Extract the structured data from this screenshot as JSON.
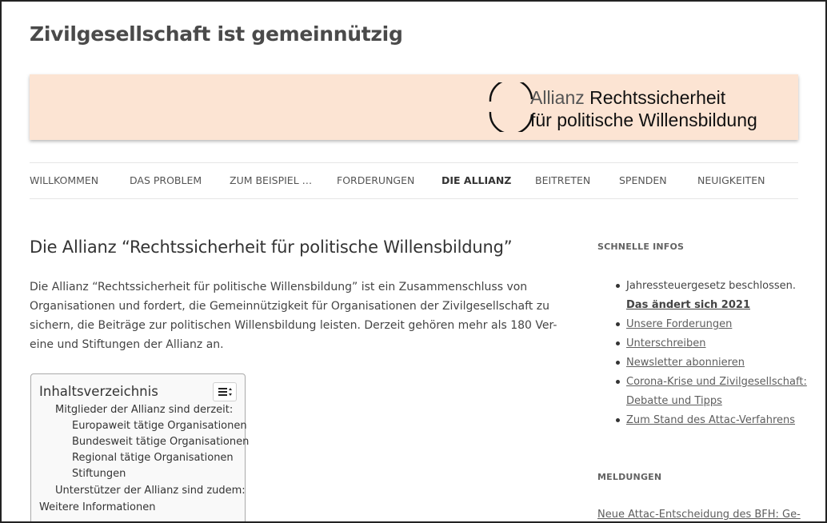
{
  "site": {
    "title": "Zivilgesellschaft ist gemeinnützig"
  },
  "banner": {
    "line1_light": "Allianz",
    "line1_bold": "Rechtssicherheit",
    "line2": "für politische Willensbildung"
  },
  "nav": {
    "items": [
      {
        "label": "Willkommen",
        "active": false
      },
      {
        "label": "Das Problem",
        "active": false
      },
      {
        "label": "Zum Beispiel …",
        "active": false
      },
      {
        "label": "Forderungen",
        "active": false
      },
      {
        "label": "Die Allianz",
        "active": true
      },
      {
        "label": "Beitreten",
        "active": false
      },
      {
        "label": "Spenden",
        "active": false
      },
      {
        "label": "Neuigkeiten",
        "active": false
      }
    ]
  },
  "entry": {
    "title": "Die Allianz “Rechtssicherheit für politische Willensbildung”",
    "lines": [
      "Die Allianz “Rechtssicherheit für politische Willensbildung” ist ein Zusammenschluss von",
      "Organisationen  und fordert, die Gemeinnützigkeit für Organisationen der Zivilgesellschaft zu",
      "sichern, die Beiträge zur politischen Willensbildung leisten. Derzeit gehören mehr als 180 Ver-",
      "eine und Stiftungen der Allianz an."
    ]
  },
  "toc": {
    "title": "Inhaltsverzeichnis",
    "toggle_icon": "list-toggle-icon",
    "items": [
      "Mitglieder der Allianz sind derzeit:",
      "Europaweit tätige Organisationen",
      "Bundesweit tätige Organisationen",
      "Regional tätige Organisationen",
      "Stiftungen",
      "Unterstützer der Allianz sind zudem:",
      "Weitere Informationen"
    ]
  },
  "sidebar": {
    "quick_info_title": "Schnelle Infos",
    "quick_info": {
      "item1_text": "Jahressteuergesetz beschlossen.",
      "item1_link": "Das ändert sich 2021",
      "item2": "Unsere Forderungen",
      "item3": "Unterschreiben",
      "item4": "Newsletter abonnieren",
      "item5_line1": "Corona-Krise und Zivilgesellschaft:",
      "item5_line2": "Debatte und Tipps",
      "item6": "Zum Stand des Attac-Verfahrens"
    },
    "news_title": "Meldungen",
    "news_link": "Neue Attac-Entscheidung des BFH: Ge-"
  },
  "colors": {
    "banner_bg": "#fce4d3",
    "text": "#444444",
    "link": "#5e5e5e"
  }
}
